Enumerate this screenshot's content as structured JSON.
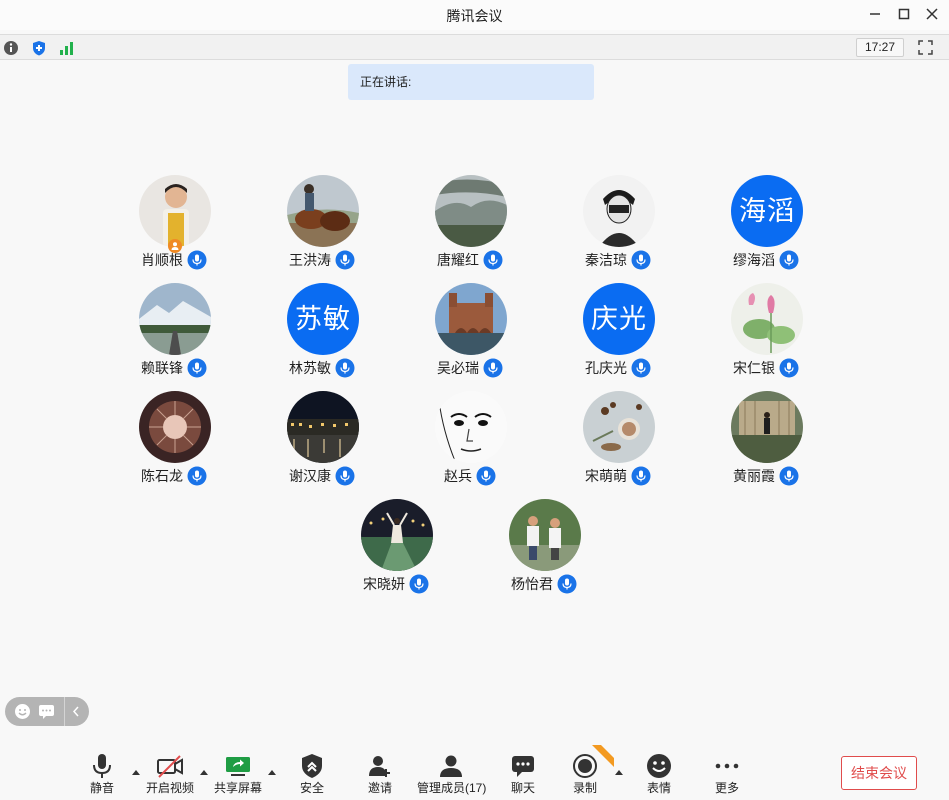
{
  "window": {
    "title": "腾讯会议"
  },
  "infobar": {
    "time": "17:27"
  },
  "speaking": {
    "label": "正在讲话:"
  },
  "participants": [
    {
      "name": "肖顺根",
      "avatar": "photo-child",
      "host": true
    },
    {
      "name": "王洪涛",
      "avatar": "photo-horses"
    },
    {
      "name": "唐耀红",
      "avatar": "photo-mountain-mist"
    },
    {
      "name": "秦洁琼",
      "avatar": "photo-sketch-portrait"
    },
    {
      "name": "缪海滔",
      "avatar_text": "海滔"
    },
    {
      "name": "赖联锋",
      "avatar": "photo-snow-road"
    },
    {
      "name": "林苏敏",
      "avatar_text": "苏敏"
    },
    {
      "name": "吴必瑞",
      "avatar": "photo-castle"
    },
    {
      "name": "孔庆光",
      "avatar_text": "庆光"
    },
    {
      "name": "宋仁银",
      "avatar": "photo-lotus"
    },
    {
      "name": "陈石龙",
      "avatar": "photo-dome"
    },
    {
      "name": "谢汉康",
      "avatar": "photo-night-city"
    },
    {
      "name": "赵兵",
      "avatar": "photo-face-sketch"
    },
    {
      "name": "宋萌萌",
      "avatar": "photo-tea-table"
    },
    {
      "name": "黄丽霞",
      "avatar": "photo-garden-woman"
    },
    {
      "name": "宋晓妍",
      "avatar": "photo-night-track"
    },
    {
      "name": "杨怡君",
      "avatar": "photo-kids-outdoor"
    }
  ],
  "toolbar": {
    "mute": "静音",
    "video": "开启视频",
    "share": "共享屏幕",
    "security": "安全",
    "invite": "邀请",
    "members": "管理成员(17)",
    "chat": "聊天",
    "record": "录制",
    "reaction": "表情",
    "more": "更多",
    "end": "结束会议"
  },
  "colors": {
    "accent": "#0a6cf2",
    "end": "#e04c4c",
    "host": "#f08a24",
    "speaking_bg": "#dae8fb"
  }
}
